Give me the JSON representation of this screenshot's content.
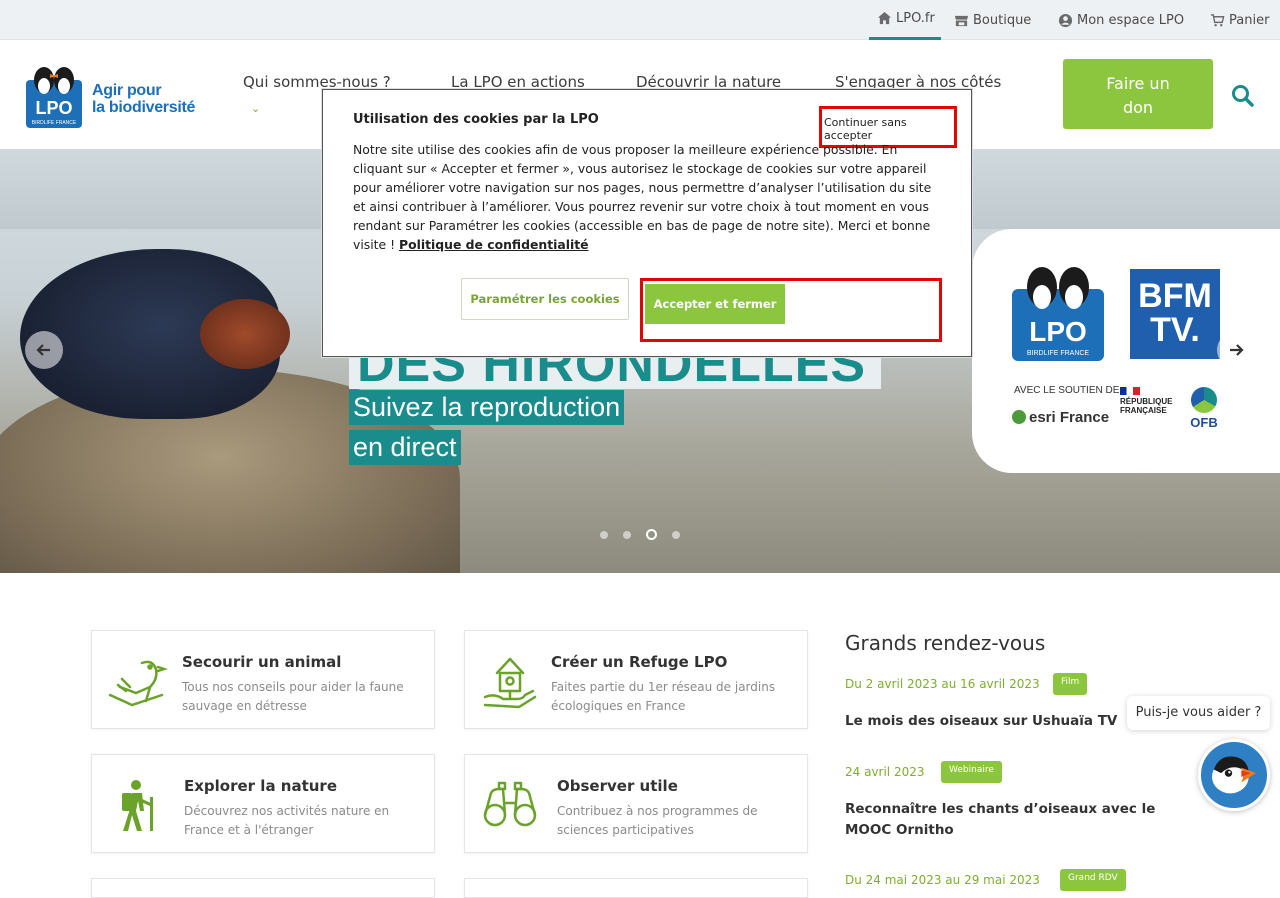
{
  "topbar": {
    "items": [
      {
        "label": "LPO.fr",
        "icon": "home-icon"
      },
      {
        "label": "Boutique",
        "icon": "store-icon"
      },
      {
        "label": "Mon espace LPO",
        "icon": "user-circle-icon"
      },
      {
        "label": "Panier",
        "icon": "cart-icon"
      }
    ]
  },
  "header": {
    "logo_tagline_line1": "Agir pour",
    "logo_tagline_line2": "la biodiversité",
    "logo_text": "LPO",
    "logo_subtext": "BIRDLIFE FRANCE",
    "nav": [
      {
        "label": "Qui sommes-nous ?"
      },
      {
        "label": "La LPO en actions"
      },
      {
        "label": "Découvrir la nature"
      },
      {
        "label": "S'engager à nos côtés"
      }
    ],
    "donate_line1": "Faire un",
    "donate_line2": "don"
  },
  "hero": {
    "headline": "DES HIRONDELLES",
    "sub_line1": "Suivez la reproduction",
    "sub_line2": "en direct",
    "partners": {
      "lpo": "LPO",
      "lpo_sub": "BIRDLIFE FRANCE",
      "bfm_line1": "BFM",
      "bfm_line2": "TV.",
      "avec": "AVEC LE SOUTIEN DE",
      "esri": "esri France",
      "rf_line1": "RÉPUBLIQUE",
      "rf_line2": "FRANÇAISE",
      "ofb": "OFB"
    },
    "slides_count": 4,
    "active_slide": 3
  },
  "cookie_modal": {
    "title": "Utilisation des cookies par la LPO",
    "continue_label": "Continuer sans accepter",
    "body": "Notre site utilise des cookies afin de vous proposer la meilleure expérience possible. En cliquant sur « Accepter et fermer », vous autorisez le stockage de cookies sur votre appareil pour améliorer votre navigation sur nos pages, nous permettre d’analyser l’utilisation du site et ainsi contribuer à l’améliorer. Vous pourrez revenir sur votre choix à tout moment en vous rendant sur Paramétrer les cookies (accessible en bas de page de notre site). Merci et bonne visite ! ",
    "privacy_link": "Politique de confidentialité",
    "param_label": "Paramétrer les cookies",
    "accept_label": "Accepter et fermer"
  },
  "cards": [
    {
      "title": "Secourir un animal",
      "desc": "Tous nos conseils pour aider la faune sauvage en détresse",
      "icon": "bird-rescue-icon"
    },
    {
      "title": "Créer un Refuge LPO",
      "desc": "Faites partie du 1er réseau de jardins écologiques en France",
      "icon": "birdhouse-hand-icon"
    },
    {
      "title": "Explorer la nature",
      "desc": "Découvrez nos activités nature en France et à l'étranger",
      "icon": "hiker-icon"
    },
    {
      "title": "Observer utile",
      "desc": "Contribuez à nos programmes de sciences participatives",
      "icon": "binoculars-icon"
    }
  ],
  "events": {
    "title": "Grands rendez-vous",
    "items": [
      {
        "date": "Du 2 avril 2023 au 16 avril 2023",
        "badge": "Film",
        "title": "Le mois des oiseaux sur Ushuaïa TV"
      },
      {
        "date": "24 avril 2023",
        "badge": "Webinaire",
        "title": "Reconnaître les chants d’oiseaux avec le MOOC Ornitho"
      },
      {
        "date": "Du 24 mai 2023 au 29 mai 2023",
        "badge": "Grand RDV",
        "title": ""
      }
    ]
  },
  "help": {
    "bubble": "Puis-je vous aider ?"
  },
  "colors": {
    "accent_green": "#8cc63f",
    "teal": "#1a8c8c",
    "highlight_red": "#e10600",
    "brand_blue": "#1d6fb8"
  }
}
